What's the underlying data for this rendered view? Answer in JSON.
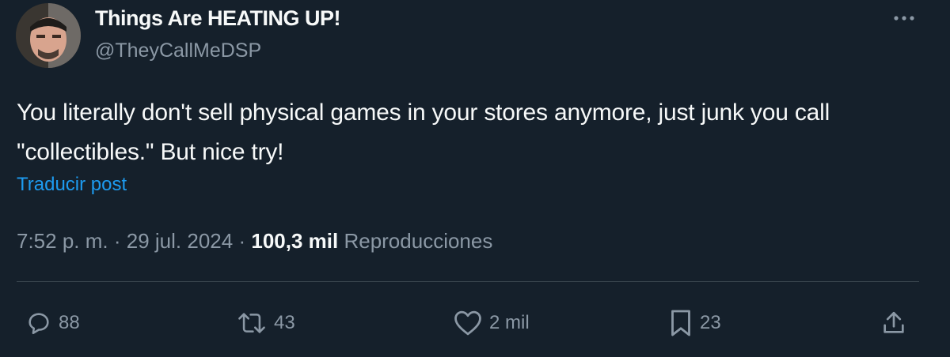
{
  "author": {
    "display_name": "Things Are HEATING UP!",
    "handle": "@TheyCallMeDSP"
  },
  "post": {
    "text": "You literally don't sell physical games in your stores anymore, just junk you call \"collectibles.\" But nice try!",
    "translate_label": "Traducir post",
    "time": "7:52 p. m.",
    "separator": "·",
    "date": "29 jul. 2024",
    "views_count": "100,3 mil",
    "views_label": "Reproducciones"
  },
  "actions": {
    "replies": "88",
    "reposts": "43",
    "likes": "2 mil",
    "bookmarks": "23"
  },
  "icons": {
    "more": "more-horizontal-icon",
    "reply": "reply-icon",
    "repost": "repost-icon",
    "like": "heart-icon",
    "bookmark": "bookmark-icon",
    "share": "share-icon"
  },
  "colors": {
    "background": "#15202b",
    "text": "#f7f9f9",
    "secondary": "#8b98a5",
    "link": "#1d9bf0",
    "divider": "#38444d"
  }
}
